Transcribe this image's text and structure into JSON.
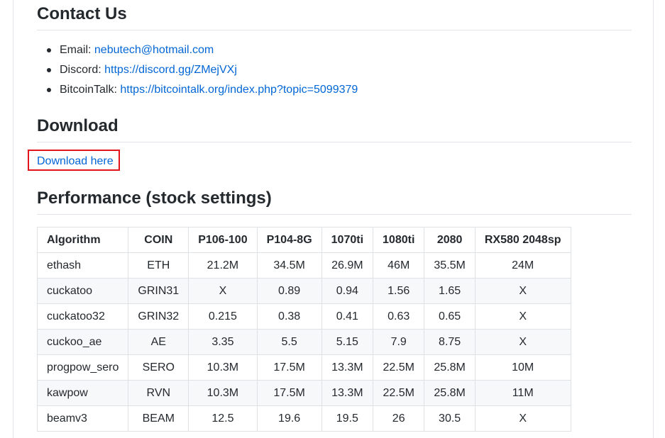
{
  "contact": {
    "heading": "Contact Us",
    "items": [
      {
        "label": "Email: ",
        "link": "nebutech@hotmail.com"
      },
      {
        "label": "Discord: ",
        "link": "https://discord.gg/ZMejVXj"
      },
      {
        "label": "BitcoinTalk: ",
        "link": "https://bitcointalk.org/index.php?topic=5099379"
      }
    ]
  },
  "download": {
    "heading": "Download",
    "link_label": "Download here",
    "highlight_color": "#e3141b"
  },
  "performance": {
    "heading": "Performance (stock settings)",
    "columns": [
      "Algorithm",
      "COIN",
      "P106-100",
      "P104-8G",
      "1070ti",
      "1080ti",
      "2080",
      "RX580 2048sp"
    ],
    "rows": [
      [
        "ethash",
        "ETH",
        "21.2M",
        "34.5M",
        "26.9M",
        "46M",
        "35.5M",
        "24M"
      ],
      [
        "cuckatoo",
        "GRIN31",
        "X",
        "0.89",
        "0.94",
        "1.56",
        "1.65",
        "X"
      ],
      [
        "cuckatoo32",
        "GRIN32",
        "0.215",
        "0.38",
        "0.41",
        "0.63",
        "0.65",
        "X"
      ],
      [
        "cuckoo_ae",
        "AE",
        "3.35",
        "5.5",
        "5.15",
        "7.9",
        "8.75",
        "X"
      ],
      [
        "progpow_sero",
        "SERO",
        "10.3M",
        "17.5M",
        "13.3M",
        "22.5M",
        "25.8M",
        "10M"
      ],
      [
        "kawpow",
        "RVN",
        "10.3M",
        "17.5M",
        "13.3M",
        "22.5M",
        "25.8M",
        "11M"
      ],
      [
        "beamv3",
        "BEAM",
        "12.5",
        "19.6",
        "19.5",
        "26",
        "30.5",
        "X"
      ]
    ]
  },
  "colors": {
    "link": "#0366d6",
    "text": "#24292e",
    "border": "#dfe2e5",
    "stripe": "#f6f8fa"
  }
}
